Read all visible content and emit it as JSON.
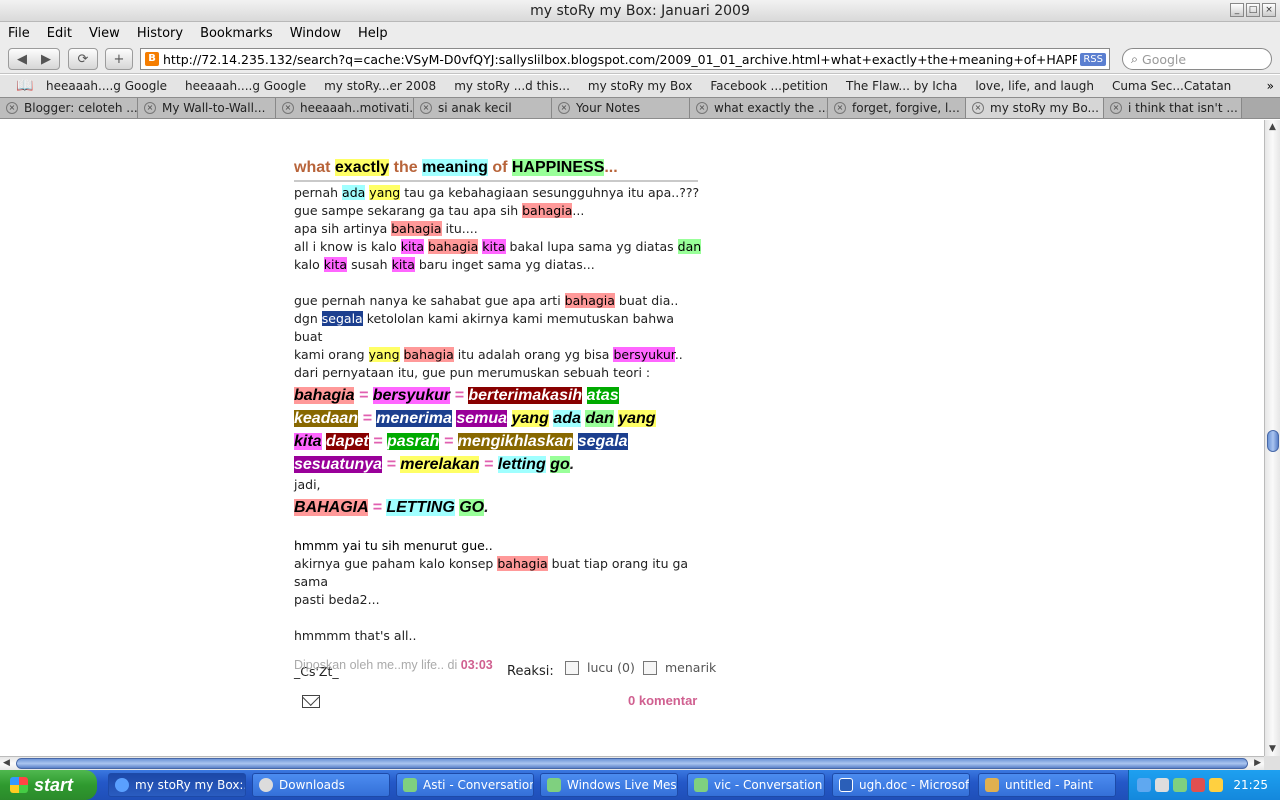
{
  "window": {
    "title": "my stoRy my Box: Januari 2009"
  },
  "menu": [
    "File",
    "Edit",
    "View",
    "History",
    "Bookmarks",
    "Window",
    "Help"
  ],
  "toolbar": {
    "url": "http://72.14.235.132/search?q=cache:VSyM-D0vfQYJ:sallyslilbox.blogspot.com/2009_01_01_archive.html+what+exactly+the+meaning+of+HAPPINESS...+",
    "rss": "RSS",
    "search_placeholder": "Google"
  },
  "bookmarks": [
    "heeaaah....g Google",
    "heeaaah....g Google",
    "my stoRy...er 2008",
    "my stoRy ...d this...",
    "my stoRy my Box",
    "Facebook ...petition",
    "The Flaw... by Icha",
    "love, life, and laugh",
    "Cuma Sec...Catatan"
  ],
  "tabs": [
    "Blogger: celoteh ...",
    "My Wall-to-Wall...",
    "heeaaah..motivati...",
    "si anak kecil",
    "Your Notes",
    "what exactly the ...",
    "forget, forgive, l...",
    "my stoRy my Bo...",
    "i think that isn't ..."
  ],
  "post": {
    "title": {
      "w1": "what",
      "w2": "exactly",
      "w3": "the",
      "w4": "meaning",
      "w5": "of",
      "w6": "HAPPINESS",
      "w7": "..."
    },
    "l1": {
      "a": "pernah",
      "b": "ada",
      "c": "yang",
      "d": "tau ga kebahagiaan sesungguhnya itu apa..???"
    },
    "l2": {
      "a": "gue sampe sekarang ga tau apa sih",
      "b": "bahagia",
      "c": "..."
    },
    "l3": {
      "a": "apa sih artinya",
      "b": "bahagia",
      "c": "itu...."
    },
    "l4": {
      "a": "all i know is kalo",
      "b": "kita",
      "c": "bahagia",
      "d": "kita",
      "e": "bakal lupa sama yg diatas",
      "f": "dan"
    },
    "l5": {
      "a": "kalo",
      "b": "kita",
      "c": "susah",
      "d": "kita",
      "e": "baru inget sama yg diatas..."
    },
    "l6": {
      "a": "gue pernah nanya ke sahabat gue apa arti",
      "b": "bahagia",
      "c": "buat dia.."
    },
    "l7": {
      "a": "dgn",
      "b": "segala",
      "c": "ketololan kami akirnya kami memutuskan bahwa buat"
    },
    "l8": {
      "a": "kami orang",
      "b": "yang",
      "c": "bahagia",
      "d": "itu adalah orang yg bisa",
      "e": "bersyukur",
      "f": ".."
    },
    "l9": "dari pernyataan itu, gue pun merumuskan sebuah teori :",
    "eq": "=",
    "t1": {
      "a": "bahagia",
      "b": "bersyukur",
      "c": "berterimakasih",
      "d": "atas"
    },
    "t2": {
      "a": "keadaan",
      "b": "menerima",
      "c": "semua",
      "d": "yang",
      "e": "ada",
      "f": "dan",
      "g": "yang"
    },
    "t3": {
      "a": "kita",
      "b": "dapet",
      "c": "pasrah",
      "d": "mengikhlaskan",
      "e": "segala"
    },
    "t4": {
      "a": "sesuatunya",
      "b": "merelakan",
      "c": "letting",
      "d": "go",
      "e": "."
    },
    "jadi": "jadi,",
    "t5": {
      "a": "BAHAGIA",
      "b": "LETTING",
      "c": "GO",
      "d": "."
    },
    "l10": "hmmm yai tu sih menurut gue..",
    "l11": {
      "a": "akirnya gue paham kalo konsep",
      "b": "bahagia",
      "c": "buat tiap orang itu ga sama"
    },
    "l12": "pasti beda2...",
    "l13": "hmmmm that's all..",
    "sig": "_Cs'Zt_"
  },
  "footer": {
    "posted_by": "Diposkan oleh me..my life.. di",
    "time": "03:03",
    "reaksi": "Reaksi:",
    "opt1": "lucu (0)",
    "opt2": "menarik",
    "comments": "0 komentar"
  },
  "taskbar": {
    "start": "start",
    "items": [
      "my stoRy my Box:...",
      "Downloads",
      "Asti - Conversation",
      "Windows Live Mes...",
      "vic - Conversation",
      "ugh.doc - Microsof...",
      "untitled - Paint"
    ],
    "clock": "21:25"
  }
}
